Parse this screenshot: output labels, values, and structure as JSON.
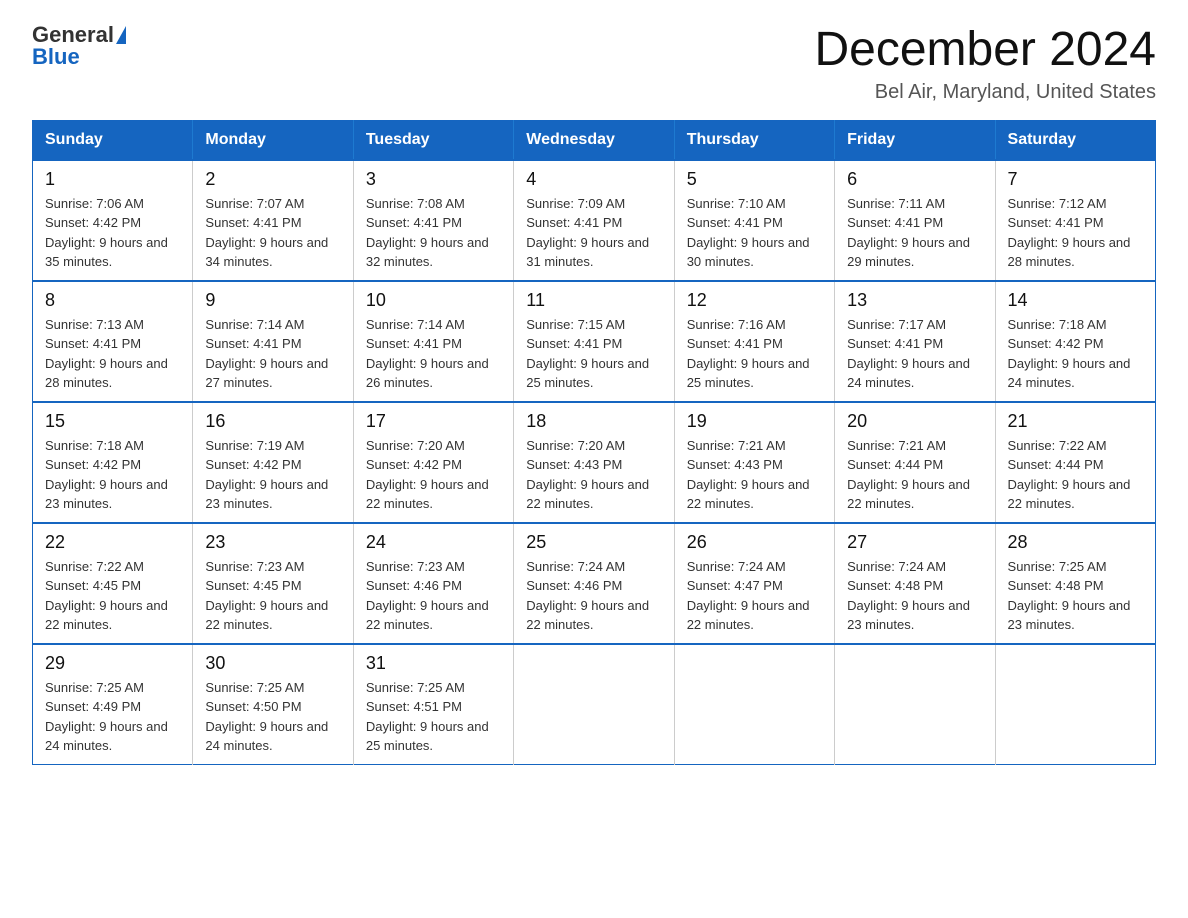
{
  "logo": {
    "general": "General",
    "blue": "Blue"
  },
  "title": "December 2024",
  "subtitle": "Bel Air, Maryland, United States",
  "days_of_week": [
    "Sunday",
    "Monday",
    "Tuesday",
    "Wednesday",
    "Thursday",
    "Friday",
    "Saturday"
  ],
  "weeks": [
    [
      {
        "day": "1",
        "sunrise": "7:06 AM",
        "sunset": "4:42 PM",
        "daylight": "9 hours and 35 minutes."
      },
      {
        "day": "2",
        "sunrise": "7:07 AM",
        "sunset": "4:41 PM",
        "daylight": "9 hours and 34 minutes."
      },
      {
        "day": "3",
        "sunrise": "7:08 AM",
        "sunset": "4:41 PM",
        "daylight": "9 hours and 32 minutes."
      },
      {
        "day": "4",
        "sunrise": "7:09 AM",
        "sunset": "4:41 PM",
        "daylight": "9 hours and 31 minutes."
      },
      {
        "day": "5",
        "sunrise": "7:10 AM",
        "sunset": "4:41 PM",
        "daylight": "9 hours and 30 minutes."
      },
      {
        "day": "6",
        "sunrise": "7:11 AM",
        "sunset": "4:41 PM",
        "daylight": "9 hours and 29 minutes."
      },
      {
        "day": "7",
        "sunrise": "7:12 AM",
        "sunset": "4:41 PM",
        "daylight": "9 hours and 28 minutes."
      }
    ],
    [
      {
        "day": "8",
        "sunrise": "7:13 AM",
        "sunset": "4:41 PM",
        "daylight": "9 hours and 28 minutes."
      },
      {
        "day": "9",
        "sunrise": "7:14 AM",
        "sunset": "4:41 PM",
        "daylight": "9 hours and 27 minutes."
      },
      {
        "day": "10",
        "sunrise": "7:14 AM",
        "sunset": "4:41 PM",
        "daylight": "9 hours and 26 minutes."
      },
      {
        "day": "11",
        "sunrise": "7:15 AM",
        "sunset": "4:41 PM",
        "daylight": "9 hours and 25 minutes."
      },
      {
        "day": "12",
        "sunrise": "7:16 AM",
        "sunset": "4:41 PM",
        "daylight": "9 hours and 25 minutes."
      },
      {
        "day": "13",
        "sunrise": "7:17 AM",
        "sunset": "4:41 PM",
        "daylight": "9 hours and 24 minutes."
      },
      {
        "day": "14",
        "sunrise": "7:18 AM",
        "sunset": "4:42 PM",
        "daylight": "9 hours and 24 minutes."
      }
    ],
    [
      {
        "day": "15",
        "sunrise": "7:18 AM",
        "sunset": "4:42 PM",
        "daylight": "9 hours and 23 minutes."
      },
      {
        "day": "16",
        "sunrise": "7:19 AM",
        "sunset": "4:42 PM",
        "daylight": "9 hours and 23 minutes."
      },
      {
        "day": "17",
        "sunrise": "7:20 AM",
        "sunset": "4:42 PM",
        "daylight": "9 hours and 22 minutes."
      },
      {
        "day": "18",
        "sunrise": "7:20 AM",
        "sunset": "4:43 PM",
        "daylight": "9 hours and 22 minutes."
      },
      {
        "day": "19",
        "sunrise": "7:21 AM",
        "sunset": "4:43 PM",
        "daylight": "9 hours and 22 minutes."
      },
      {
        "day": "20",
        "sunrise": "7:21 AM",
        "sunset": "4:44 PM",
        "daylight": "9 hours and 22 minutes."
      },
      {
        "day": "21",
        "sunrise": "7:22 AM",
        "sunset": "4:44 PM",
        "daylight": "9 hours and 22 minutes."
      }
    ],
    [
      {
        "day": "22",
        "sunrise": "7:22 AM",
        "sunset": "4:45 PM",
        "daylight": "9 hours and 22 minutes."
      },
      {
        "day": "23",
        "sunrise": "7:23 AM",
        "sunset": "4:45 PM",
        "daylight": "9 hours and 22 minutes."
      },
      {
        "day": "24",
        "sunrise": "7:23 AM",
        "sunset": "4:46 PM",
        "daylight": "9 hours and 22 minutes."
      },
      {
        "day": "25",
        "sunrise": "7:24 AM",
        "sunset": "4:46 PM",
        "daylight": "9 hours and 22 minutes."
      },
      {
        "day": "26",
        "sunrise": "7:24 AM",
        "sunset": "4:47 PM",
        "daylight": "9 hours and 22 minutes."
      },
      {
        "day": "27",
        "sunrise": "7:24 AM",
        "sunset": "4:48 PM",
        "daylight": "9 hours and 23 minutes."
      },
      {
        "day": "28",
        "sunrise": "7:25 AM",
        "sunset": "4:48 PM",
        "daylight": "9 hours and 23 minutes."
      }
    ],
    [
      {
        "day": "29",
        "sunrise": "7:25 AM",
        "sunset": "4:49 PM",
        "daylight": "9 hours and 24 minutes."
      },
      {
        "day": "30",
        "sunrise": "7:25 AM",
        "sunset": "4:50 PM",
        "daylight": "9 hours and 24 minutes."
      },
      {
        "day": "31",
        "sunrise": "7:25 AM",
        "sunset": "4:51 PM",
        "daylight": "9 hours and 25 minutes."
      },
      null,
      null,
      null,
      null
    ]
  ],
  "labels": {
    "sunrise": "Sunrise:",
    "sunset": "Sunset:",
    "daylight": "Daylight:"
  }
}
